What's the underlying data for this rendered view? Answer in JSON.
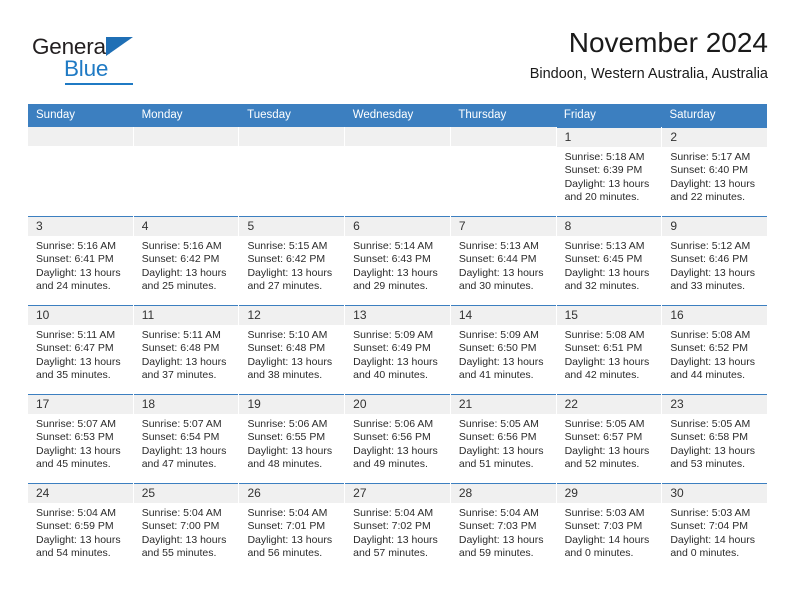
{
  "brand": {
    "name_part1": "General",
    "name_part2": "Blue",
    "triangle_icon": "blue-triangle-icon",
    "accent_color": "#1f7ac4"
  },
  "header": {
    "title": "November 2024",
    "subtitle": "Bindoon, Western Australia, Australia"
  },
  "calendar": {
    "header_color": "#3c7fc0",
    "daynum_band_color": "#f0f0f0",
    "weekdays": [
      "Sunday",
      "Monday",
      "Tuesday",
      "Wednesday",
      "Thursday",
      "Friday",
      "Saturday"
    ],
    "weeks": [
      [
        {
          "day": "",
          "empty": true
        },
        {
          "day": "",
          "empty": true
        },
        {
          "day": "",
          "empty": true
        },
        {
          "day": "",
          "empty": true
        },
        {
          "day": "",
          "empty": true
        },
        {
          "day": "1",
          "sunrise": "Sunrise: 5:18 AM",
          "sunset": "Sunset: 6:39 PM",
          "daylight1": "Daylight: 13 hours",
          "daylight2": "and 20 minutes."
        },
        {
          "day": "2",
          "sunrise": "Sunrise: 5:17 AM",
          "sunset": "Sunset: 6:40 PM",
          "daylight1": "Daylight: 13 hours",
          "daylight2": "and 22 minutes."
        }
      ],
      [
        {
          "day": "3",
          "sunrise": "Sunrise: 5:16 AM",
          "sunset": "Sunset: 6:41 PM",
          "daylight1": "Daylight: 13 hours",
          "daylight2": "and 24 minutes."
        },
        {
          "day": "4",
          "sunrise": "Sunrise: 5:16 AM",
          "sunset": "Sunset: 6:42 PM",
          "daylight1": "Daylight: 13 hours",
          "daylight2": "and 25 minutes."
        },
        {
          "day": "5",
          "sunrise": "Sunrise: 5:15 AM",
          "sunset": "Sunset: 6:42 PM",
          "daylight1": "Daylight: 13 hours",
          "daylight2": "and 27 minutes."
        },
        {
          "day": "6",
          "sunrise": "Sunrise: 5:14 AM",
          "sunset": "Sunset: 6:43 PM",
          "daylight1": "Daylight: 13 hours",
          "daylight2": "and 29 minutes."
        },
        {
          "day": "7",
          "sunrise": "Sunrise: 5:13 AM",
          "sunset": "Sunset: 6:44 PM",
          "daylight1": "Daylight: 13 hours",
          "daylight2": "and 30 minutes."
        },
        {
          "day": "8",
          "sunrise": "Sunrise: 5:13 AM",
          "sunset": "Sunset: 6:45 PM",
          "daylight1": "Daylight: 13 hours",
          "daylight2": "and 32 minutes."
        },
        {
          "day": "9",
          "sunrise": "Sunrise: 5:12 AM",
          "sunset": "Sunset: 6:46 PM",
          "daylight1": "Daylight: 13 hours",
          "daylight2": "and 33 minutes."
        }
      ],
      [
        {
          "day": "10",
          "sunrise": "Sunrise: 5:11 AM",
          "sunset": "Sunset: 6:47 PM",
          "daylight1": "Daylight: 13 hours",
          "daylight2": "and 35 minutes."
        },
        {
          "day": "11",
          "sunrise": "Sunrise: 5:11 AM",
          "sunset": "Sunset: 6:48 PM",
          "daylight1": "Daylight: 13 hours",
          "daylight2": "and 37 minutes."
        },
        {
          "day": "12",
          "sunrise": "Sunrise: 5:10 AM",
          "sunset": "Sunset: 6:48 PM",
          "daylight1": "Daylight: 13 hours",
          "daylight2": "and 38 minutes."
        },
        {
          "day": "13",
          "sunrise": "Sunrise: 5:09 AM",
          "sunset": "Sunset: 6:49 PM",
          "daylight1": "Daylight: 13 hours",
          "daylight2": "and 40 minutes."
        },
        {
          "day": "14",
          "sunrise": "Sunrise: 5:09 AM",
          "sunset": "Sunset: 6:50 PM",
          "daylight1": "Daylight: 13 hours",
          "daylight2": "and 41 minutes."
        },
        {
          "day": "15",
          "sunrise": "Sunrise: 5:08 AM",
          "sunset": "Sunset: 6:51 PM",
          "daylight1": "Daylight: 13 hours",
          "daylight2": "and 42 minutes."
        },
        {
          "day": "16",
          "sunrise": "Sunrise: 5:08 AM",
          "sunset": "Sunset: 6:52 PM",
          "daylight1": "Daylight: 13 hours",
          "daylight2": "and 44 minutes."
        }
      ],
      [
        {
          "day": "17",
          "sunrise": "Sunrise: 5:07 AM",
          "sunset": "Sunset: 6:53 PM",
          "daylight1": "Daylight: 13 hours",
          "daylight2": "and 45 minutes."
        },
        {
          "day": "18",
          "sunrise": "Sunrise: 5:07 AM",
          "sunset": "Sunset: 6:54 PM",
          "daylight1": "Daylight: 13 hours",
          "daylight2": "and 47 minutes."
        },
        {
          "day": "19",
          "sunrise": "Sunrise: 5:06 AM",
          "sunset": "Sunset: 6:55 PM",
          "daylight1": "Daylight: 13 hours",
          "daylight2": "and 48 minutes."
        },
        {
          "day": "20",
          "sunrise": "Sunrise: 5:06 AM",
          "sunset": "Sunset: 6:56 PM",
          "daylight1": "Daylight: 13 hours",
          "daylight2": "and 49 minutes."
        },
        {
          "day": "21",
          "sunrise": "Sunrise: 5:05 AM",
          "sunset": "Sunset: 6:56 PM",
          "daylight1": "Daylight: 13 hours",
          "daylight2": "and 51 minutes."
        },
        {
          "day": "22",
          "sunrise": "Sunrise: 5:05 AM",
          "sunset": "Sunset: 6:57 PM",
          "daylight1": "Daylight: 13 hours",
          "daylight2": "and 52 minutes."
        },
        {
          "day": "23",
          "sunrise": "Sunrise: 5:05 AM",
          "sunset": "Sunset: 6:58 PM",
          "daylight1": "Daylight: 13 hours",
          "daylight2": "and 53 minutes."
        }
      ],
      [
        {
          "day": "24",
          "sunrise": "Sunrise: 5:04 AM",
          "sunset": "Sunset: 6:59 PM",
          "daylight1": "Daylight: 13 hours",
          "daylight2": "and 54 minutes."
        },
        {
          "day": "25",
          "sunrise": "Sunrise: 5:04 AM",
          "sunset": "Sunset: 7:00 PM",
          "daylight1": "Daylight: 13 hours",
          "daylight2": "and 55 minutes."
        },
        {
          "day": "26",
          "sunrise": "Sunrise: 5:04 AM",
          "sunset": "Sunset: 7:01 PM",
          "daylight1": "Daylight: 13 hours",
          "daylight2": "and 56 minutes."
        },
        {
          "day": "27",
          "sunrise": "Sunrise: 5:04 AM",
          "sunset": "Sunset: 7:02 PM",
          "daylight1": "Daylight: 13 hours",
          "daylight2": "and 57 minutes."
        },
        {
          "day": "28",
          "sunrise": "Sunrise: 5:04 AM",
          "sunset": "Sunset: 7:03 PM",
          "daylight1": "Daylight: 13 hours",
          "daylight2": "and 59 minutes."
        },
        {
          "day": "29",
          "sunrise": "Sunrise: 5:03 AM",
          "sunset": "Sunset: 7:03 PM",
          "daylight1": "Daylight: 14 hours",
          "daylight2": "and 0 minutes."
        },
        {
          "day": "30",
          "sunrise": "Sunrise: 5:03 AM",
          "sunset": "Sunset: 7:04 PM",
          "daylight1": "Daylight: 14 hours",
          "daylight2": "and 0 minutes."
        }
      ]
    ]
  }
}
